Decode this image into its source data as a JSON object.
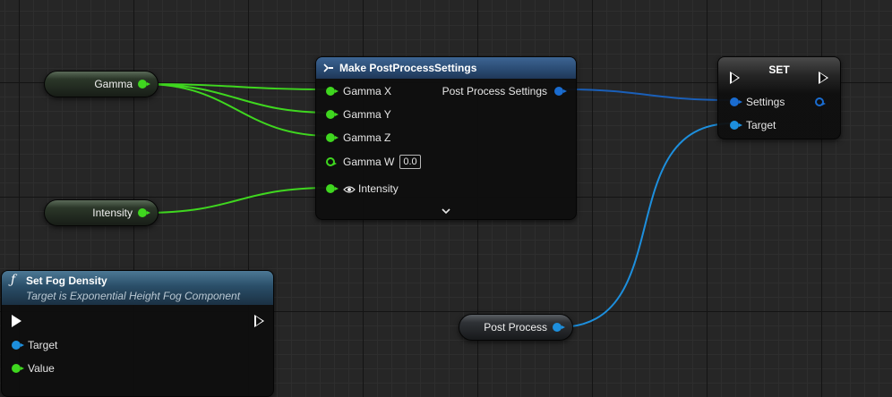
{
  "make_node": {
    "title": "Make PostProcessSettings",
    "inputs": {
      "gamma_x": "Gamma X",
      "gamma_y": "Gamma Y",
      "gamma_z": "Gamma Z",
      "gamma_w": "Gamma W",
      "gamma_w_value": "0.0",
      "intensity": "Intensity"
    },
    "output": "Post Process Settings",
    "expand_icon": "chevron-down-icon"
  },
  "set_node": {
    "title": "SET",
    "settings": "Settings",
    "target": "Target"
  },
  "fog_node": {
    "icon": "ƒ",
    "title": "Set Fog Density",
    "subtitle": "Target is Exponential Height Fog Component",
    "target": "Target",
    "value": "Value"
  },
  "variables": {
    "gamma": "Gamma",
    "intensity": "Intensity",
    "post_process": "Post Process"
  },
  "colors": {
    "float_pin": "#3fd71f",
    "object_pin": "#1d8fdd",
    "struct_pin": "#1a6cd0",
    "make_header": "#2b4c74",
    "fog_header": "#2a4e68"
  }
}
